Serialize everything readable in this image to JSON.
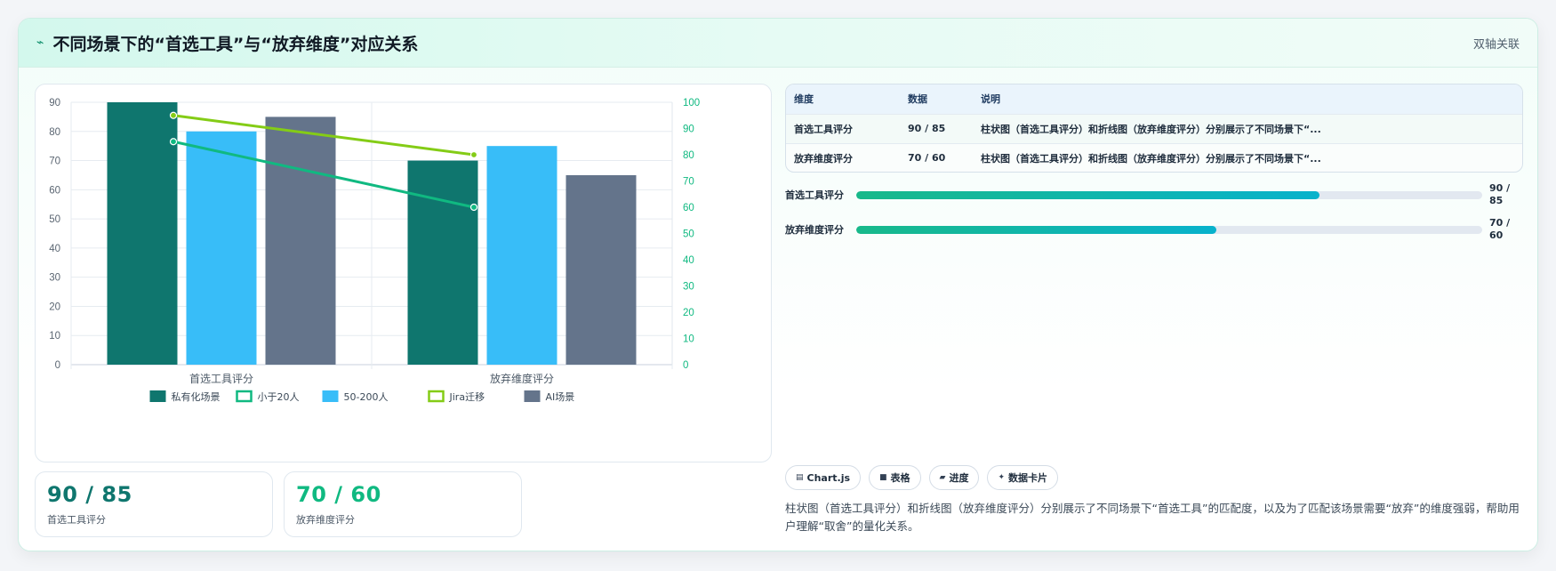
{
  "header": {
    "icon": "bolt-icon",
    "title": "不同场景下的“首选工具”与“放弃维度”对应关系",
    "tag": "双轴关联"
  },
  "chart_data": {
    "type": "bar",
    "categories": [
      "首选工具评分",
      "放弃维度评分"
    ],
    "bar_series": [
      {
        "name": "私有化场景",
        "color": "#0f766e",
        "values": [
          90,
          70
        ]
      },
      {
        "name": "50-200人",
        "color": "#38bdf8",
        "values": [
          80,
          75
        ]
      },
      {
        "name": "AI场景",
        "color": "#64748b",
        "values": [
          85,
          65
        ]
      }
    ],
    "line_series": [
      {
        "name": "小于20人",
        "color": "#10b981",
        "values": [
          85,
          60
        ]
      },
      {
        "name": "Jira迁移",
        "color": "#84cc16",
        "values": [
          95,
          80
        ]
      }
    ],
    "legend": [
      "私有化场景",
      "小于20人",
      "50-200人",
      "Jira迁移",
      "AI场景"
    ],
    "legend_types": {
      "私有化场景": "bar",
      "小于20人": "line",
      "50-200人": "bar",
      "Jira迁移": "line",
      "AI场景": "bar"
    },
    "y_left": {
      "min": 0,
      "max": 90,
      "ticks": [
        0,
        10,
        20,
        30,
        40,
        50,
        60,
        70,
        80,
        90
      ]
    },
    "y_right": {
      "min": 0,
      "max": 100,
      "ticks": [
        0,
        10,
        20,
        30,
        40,
        50,
        60,
        70,
        80,
        90,
        100
      ]
    },
    "grid": true,
    "legend_position": "bottom"
  },
  "stats": [
    {
      "value": "90 / 85",
      "label": "首选工具评分",
      "color": "#0f766e"
    },
    {
      "value": "70 / 60",
      "label": "放弃维度评分",
      "color": "#10b981"
    }
  ],
  "table": {
    "headers": [
      "维度",
      "数据",
      "说明"
    ],
    "rows": [
      [
        "首选工具评分",
        "90 / 85",
        "柱状图（首选工具评分）和折线图（放弃维度评分）分别展示了不同场景下“..."
      ],
      [
        "放弃维度评分",
        "70 / 60",
        "柱状图（首选工具评分）和折线图（放弃维度评分）分别展示了不同场景下“..."
      ]
    ]
  },
  "progress": [
    {
      "label": "首选工具评分",
      "value": "90 / 85",
      "fraction": 0.74
    },
    {
      "label": "放弃维度评分",
      "value": "70 / 60",
      "fraction": 0.575
    }
  ],
  "chips": [
    {
      "icon": "chart-icon",
      "glyph": "▤",
      "label": "Chart.js"
    },
    {
      "icon": "table-icon",
      "glyph": "■",
      "label": "表格"
    },
    {
      "icon": "progress-icon",
      "glyph": "▰",
      "label": "进度"
    },
    {
      "icon": "sparkle-icon",
      "glyph": "✦",
      "label": "数据卡片"
    }
  ],
  "description": "柱状图（首选工具评分）和折线图（放弃维度评分）分别展示了不同场景下“首选工具”的匹配度，以及为了匹配该场景需要“放弃”的维度强弱，帮助用户理解“取舍”的量化关系。"
}
